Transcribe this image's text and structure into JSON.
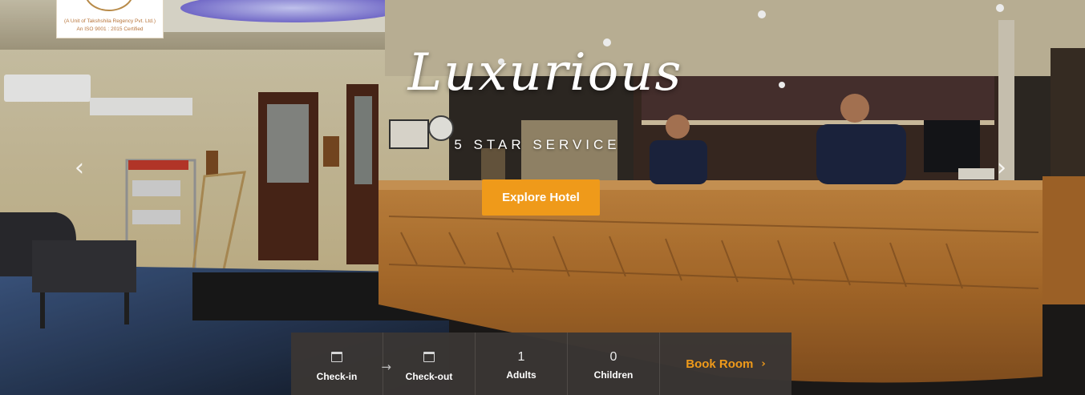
{
  "logo": {
    "line1": "(A Unit of Takshshila Regency Pvt. Ltd.)",
    "line2": "An ISO 9001 : 2015 Certified"
  },
  "hero": {
    "title": "Luxurious",
    "subtitle": "5 STAR SERVICE",
    "cta_label": "Explore Hotel",
    "prev_icon": "chevron-left-icon",
    "next_icon": "chevron-right-icon"
  },
  "booking": {
    "checkin_label": "Check-in",
    "checkout_label": "Check-out",
    "adults_value": "1",
    "adults_label": "Adults",
    "children_value": "0",
    "children_label": "Children",
    "book_label": "Book Room",
    "calendar_icon": "calendar-icon",
    "arrow_icon": "arrow-right-icon"
  },
  "colors": {
    "accent": "#ef9a1a",
    "bar_bg": "#3a3634",
    "text_light": "#ffffff"
  }
}
